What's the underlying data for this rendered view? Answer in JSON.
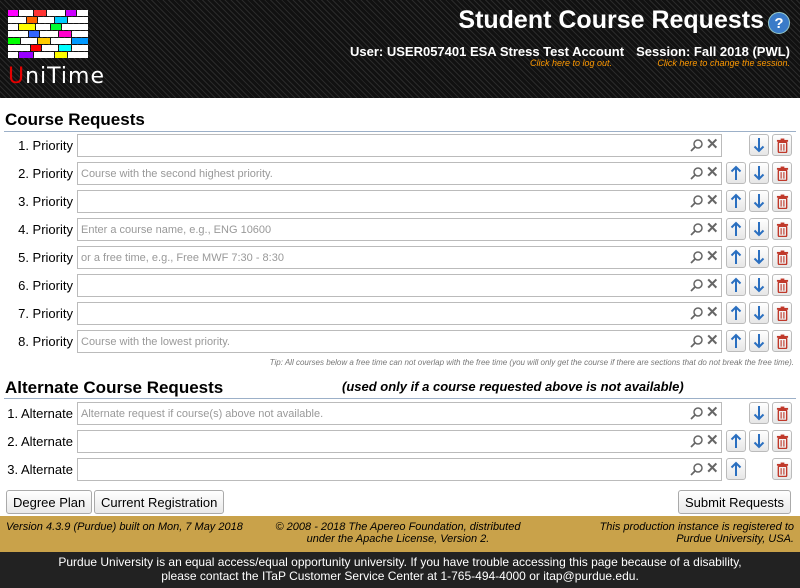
{
  "header": {
    "logo_u": "U",
    "logo_rest": "niTime",
    "title": "Student Course Requests",
    "help_icon": "?",
    "user": "User: USER057401 ESA Stress Test Account",
    "logout_hint": "Click here to log out.",
    "session": "Session: Fall 2018 (PWL)",
    "session_hint": "Click here to change the session."
  },
  "course_requests": {
    "title": "Course Requests",
    "rows": [
      {
        "label": "1. Priority",
        "value": "",
        "placeholder": ""
      },
      {
        "label": "2. Priority",
        "value": "",
        "placeholder": "Course with the second highest priority."
      },
      {
        "label": "3. Priority",
        "value": "",
        "placeholder": ""
      },
      {
        "label": "4. Priority",
        "value": "",
        "placeholder": "Enter a course name, e.g., ENG 10600"
      },
      {
        "label": "5. Priority",
        "value": "",
        "placeholder": "or a free time, e.g., Free MWF 7:30 - 8:30"
      },
      {
        "label": "6. Priority",
        "value": "",
        "placeholder": ""
      },
      {
        "label": "7. Priority",
        "value": "",
        "placeholder": ""
      },
      {
        "label": "8. Priority",
        "value": "",
        "placeholder": "Course with the lowest priority."
      }
    ],
    "tip": "Tip: All courses below a free time can not overlap with the free time (you will only get the course if there are sections that do not break the free time)."
  },
  "alternate_requests": {
    "title": "Alternate Course Requests",
    "note": "(used only if a course requested above is not available)",
    "rows": [
      {
        "label": "1. Alternate",
        "value": "",
        "placeholder": "Alternate request if course(s) above not available."
      },
      {
        "label": "2. Alternate",
        "value": "",
        "placeholder": ""
      },
      {
        "label": "3. Alternate",
        "value": "",
        "placeholder": ""
      }
    ]
  },
  "buttons": {
    "degree_plan": "Degree Plan",
    "current_registration": "Current Registration",
    "submit": "Submit Requests"
  },
  "footer": {
    "version": "Version 4.3.9 (Purdue) built on Mon, 7 May 2018",
    "copyright": "© 2008 - 2018 The Apereo Foundation, distributed under the Apache License, Version 2.",
    "instance": "This production instance is registered to Purdue University, USA.",
    "notice_line1": "Purdue University is an equal access/equal opportunity university. If you have trouble accessing this page because of a disability,",
    "notice_line2": "please contact the ITaP Customer Service Center at 1-765-494-4000 or itap@purdue.edu."
  },
  "colors": {
    "header_bg": "#111111",
    "footer_gold": "#c9a24a",
    "footer_dark": "#222222",
    "arrow_blue": "#2a6fc0",
    "delete_red": "#c0392b",
    "hint_orange": "#ff9900"
  }
}
